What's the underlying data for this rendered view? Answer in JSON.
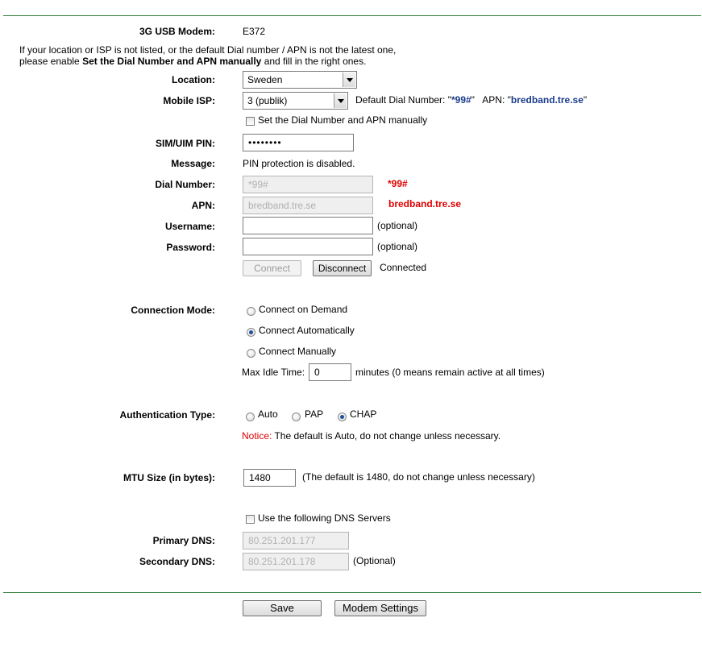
{
  "modem": {
    "label": "3G USB Modem:",
    "value": "E372"
  },
  "intro": {
    "line1": "If your location or ISP is not listed, or the default Dial number / APN is not the latest one,",
    "line2_pre": "please enable ",
    "line2_bold": "Set the Dial Number and APN manually",
    "line2_post": " and fill in the right ones."
  },
  "location": {
    "label": "Location:",
    "selected": "Sweden"
  },
  "isp": {
    "label": "Mobile ISP:",
    "selected": "3 (publik)",
    "default_dial_prefix": "Default Dial Number: \"",
    "default_dial": "*99#",
    "apn_prefix": "\"   APN: \"",
    "default_apn": "bredband.tre.se",
    "apn_suffix": "\""
  },
  "manual_checkbox": {
    "label": "Set the Dial Number and APN manually",
    "checked": false
  },
  "pin": {
    "label": "SIM/UIM PIN:",
    "value": "••••••••"
  },
  "message": {
    "label": "Message:",
    "value": "PIN protection is disabled."
  },
  "dial_number": {
    "label": "Dial Number:",
    "value": "*99#",
    "annotation": "*99#"
  },
  "apn": {
    "label": "APN:",
    "value": "bredband.tre.se",
    "annotation": "bredband.tre.se"
  },
  "username": {
    "label": "Username:",
    "value": "",
    "hint": "(optional)"
  },
  "password": {
    "label": "Password:",
    "value": "",
    "hint": "(optional)"
  },
  "connect": {
    "connect_label": "Connect",
    "disconnect_label": "Disconnect",
    "status": "Connected"
  },
  "connection_mode": {
    "label": "Connection Mode:",
    "options": [
      "Connect on Demand",
      "Connect Automatically",
      "Connect Manually"
    ],
    "selected_index": 1,
    "max_idle_label": "Max Idle Time:",
    "max_idle_value": "0",
    "max_idle_hint": "minutes (0 means remain active at all times)"
  },
  "auth": {
    "label": "Authentication Type:",
    "options": [
      "Auto",
      "PAP",
      "CHAP"
    ],
    "selected_index": 2,
    "notice_label": "Notice:",
    "notice_text": " The default is Auto, do not change unless necessary."
  },
  "mtu": {
    "label": "MTU Size (in bytes):",
    "value": "1480",
    "hint": "(The default is 1480, do not change unless necessary)"
  },
  "dns": {
    "checkbox_label": "Use the following DNS Servers",
    "checked": false,
    "primary_label": "Primary DNS:",
    "primary_value": "80.251.201.177",
    "secondary_label": "Secondary DNS:",
    "secondary_value": "80.251.201.178",
    "secondary_hint": "(Optional)"
  },
  "footer": {
    "save_label": "Save",
    "modem_settings_label": "Modem Settings"
  },
  "colors": {
    "rule": "#2e7d3a",
    "annotation_red": "#e00000",
    "default_blue": "#1a3c8c"
  }
}
